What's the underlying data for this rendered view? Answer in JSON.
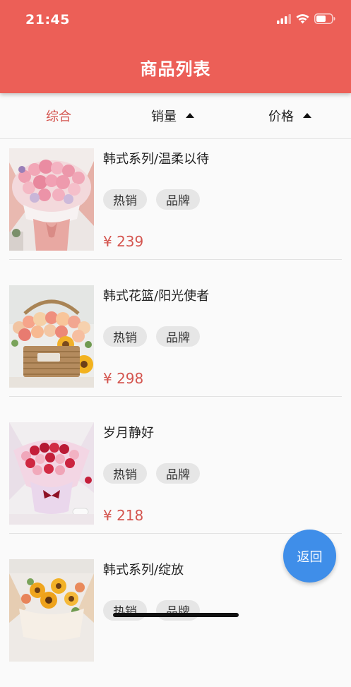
{
  "status_bar": {
    "time": "21:45",
    "icons": [
      "signal-icon",
      "wifi-icon",
      "battery-icon"
    ]
  },
  "header": {
    "title": "商品列表"
  },
  "sort_tabs": [
    {
      "label": "综合",
      "active": true
    },
    {
      "label": "销量",
      "active": false
    },
    {
      "label": "价格",
      "active": false
    }
  ],
  "products": [
    {
      "name": "韩式系列/温柔以待",
      "tags": [
        "热销",
        "品牌"
      ],
      "price": "¥ 239"
    },
    {
      "name": "韩式花篮/阳光使者",
      "tags": [
        "热销",
        "品牌"
      ],
      "price": "¥ 298"
    },
    {
      "name": "岁月静好",
      "tags": [
        "热销",
        "品牌"
      ],
      "price": "¥ 218"
    },
    {
      "name": "韩式系列/绽放",
      "tags": [
        "热销",
        "品牌"
      ],
      "price": ""
    }
  ],
  "back_button": {
    "label": "返回"
  },
  "colors": {
    "header": "#ec5f57",
    "accent_text": "#d4554f",
    "back_button": "#3f8ee9",
    "tag_bg": "#e6e6e6"
  }
}
